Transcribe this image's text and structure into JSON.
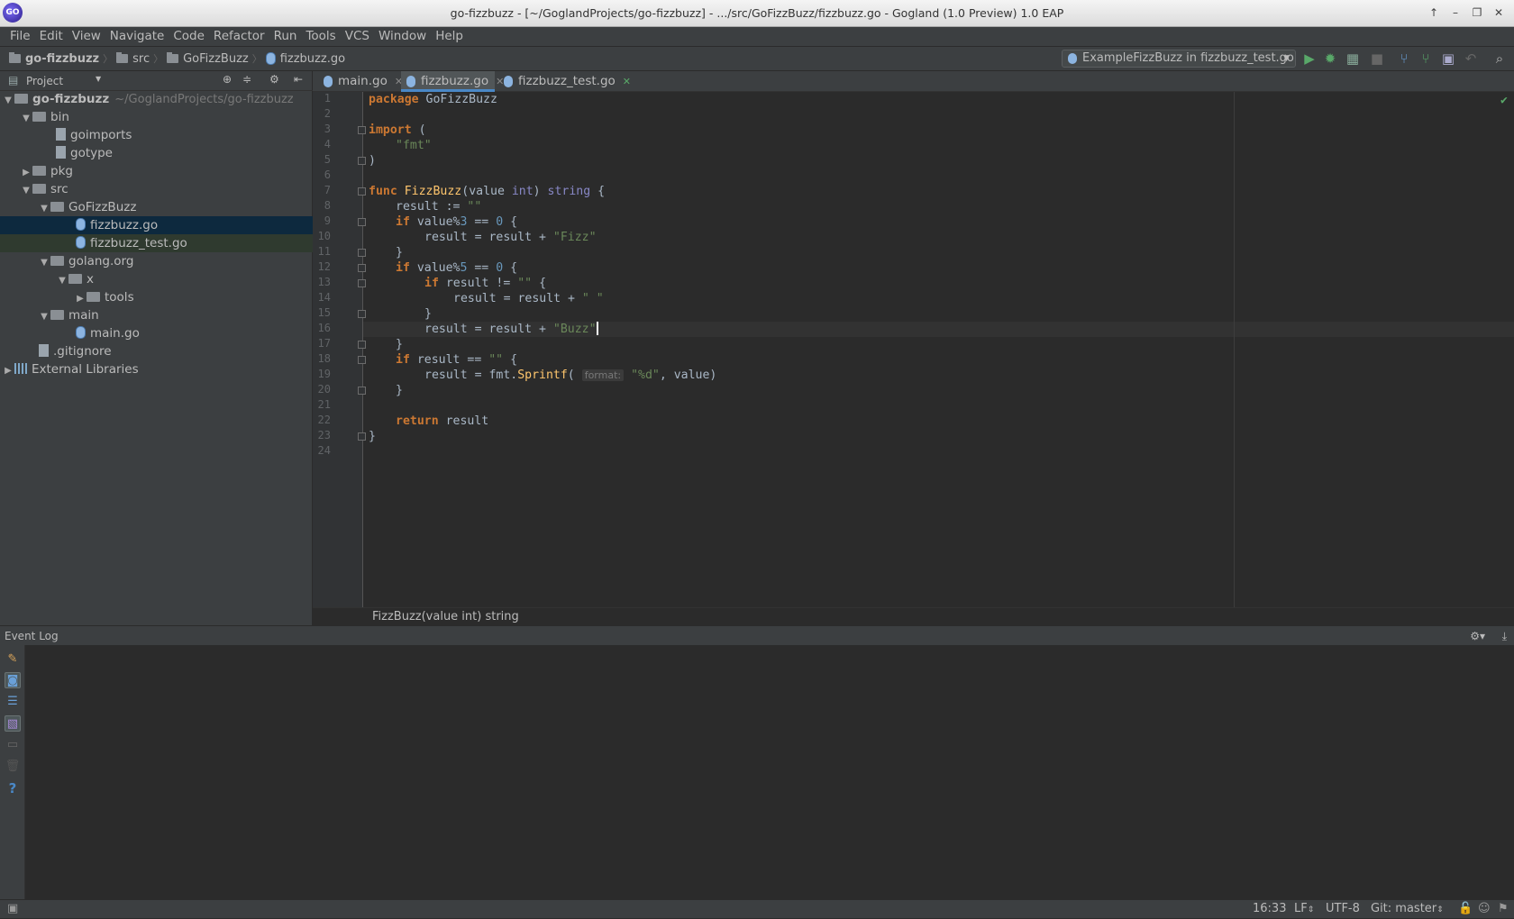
{
  "window": {
    "title": "go-fizzbuzz - [~/GoglandProjects/go-fizzbuzz] - .../src/GoFizzBuzz/fizzbuzz.go - Gogland (1.0 Preview) 1.0 EAP",
    "logo": "GO"
  },
  "menu": [
    "File",
    "Edit",
    "View",
    "Navigate",
    "Code",
    "Refactor",
    "Run",
    "Tools",
    "VCS",
    "Window",
    "Help"
  ],
  "navbar": {
    "crumbs": [
      "go-fizzbuzz",
      "src",
      "GoFizzBuzz",
      "fizzbuzz.go"
    ],
    "run_config": "ExampleFizzBuzz in fizzbuzz_test.go"
  },
  "project": {
    "header": "Project",
    "root": "go-fizzbuzz",
    "root_path": "~/GoglandProjects/go-fizzbuzz",
    "tree": [
      {
        "label": "bin"
      },
      {
        "label": "goimports"
      },
      {
        "label": "gotype"
      },
      {
        "label": "pkg"
      },
      {
        "label": "src"
      },
      {
        "label": "GoFizzBuzz"
      },
      {
        "label": "fizzbuzz.go"
      },
      {
        "label": "fizzbuzz_test.go"
      },
      {
        "label": "golang.org"
      },
      {
        "label": "x"
      },
      {
        "label": "tools"
      },
      {
        "label": "main"
      },
      {
        "label": "main.go"
      },
      {
        "label": ".gitignore"
      },
      {
        "label": "External Libraries"
      }
    ]
  },
  "tabs": [
    {
      "label": "main.go"
    },
    {
      "label": "fizzbuzz.go"
    },
    {
      "label": "fizzbuzz_test.go"
    }
  ],
  "editor": {
    "line_numbers": [
      "1",
      "2",
      "3",
      "4",
      "5",
      "6",
      "7",
      "8",
      "9",
      "10",
      "11",
      "12",
      "13",
      "14",
      "15",
      "16",
      "17",
      "18",
      "19",
      "20",
      "21",
      "22",
      "23",
      "24"
    ],
    "code": {
      "l1_kw": "package",
      "l1_rest": " GoFizzBuzz",
      "l3_kw": "import",
      "l3_rest": " (",
      "l4": "\"fmt\"",
      "l5": ")",
      "l7_kw": "func",
      "l7_fn": "FizzBuzz",
      "l7_a": "(value ",
      "l7_t1": "int",
      "l7_b": ") ",
      "l7_t2": "string",
      "l7_c": " {",
      "l8_a": "result := ",
      "l8_s": "\"\"",
      "l9_kw": "if",
      "l9_a": " value%",
      "l9_n1": "3",
      "l9_b": " == ",
      "l9_n2": "0",
      "l9_c": " {",
      "l10_a": "result = result + ",
      "l10_s": "\"Fizz\"",
      "l11": "}",
      "l12_kw": "if",
      "l12_a": " value%",
      "l12_n1": "5",
      "l12_b": " == ",
      "l12_n2": "0",
      "l12_c": " {",
      "l13_kw": "if",
      "l13_a": " result != ",
      "l13_s": "\"\"",
      "l13_c": " {",
      "l14_a": "result = result + ",
      "l14_s": "\" \"",
      "l15": "}",
      "l16_a": "result = result + ",
      "l16_s": "\"Buzz\"",
      "l17": "}",
      "l18_kw": "if",
      "l18_a": " result == ",
      "l18_s": "\"\"",
      "l18_c": " {",
      "l19_a": "result = fmt.",
      "l19_fn": "Sprintf",
      "l19_b": "(",
      "l19_hint": "format:",
      "l19_s": "\"%d\"",
      "l19_c": ", value)",
      "l20": "}",
      "l22_kw": "return",
      "l22_rest": " result",
      "l23": "}"
    },
    "signature": "FizzBuzz(value int) string"
  },
  "event_log": {
    "title": "Event Log"
  },
  "status": {
    "position": "16:33",
    "line_sep": "LF",
    "encoding": "UTF-8",
    "vcs": "Git: master"
  },
  "colors": {
    "background": "#2b2b2b",
    "panel": "#3c3f41",
    "keyword": "#cc7832",
    "string": "#6a8759",
    "number": "#6897bb",
    "function": "#ffc66d",
    "run_green": "#59a869"
  }
}
